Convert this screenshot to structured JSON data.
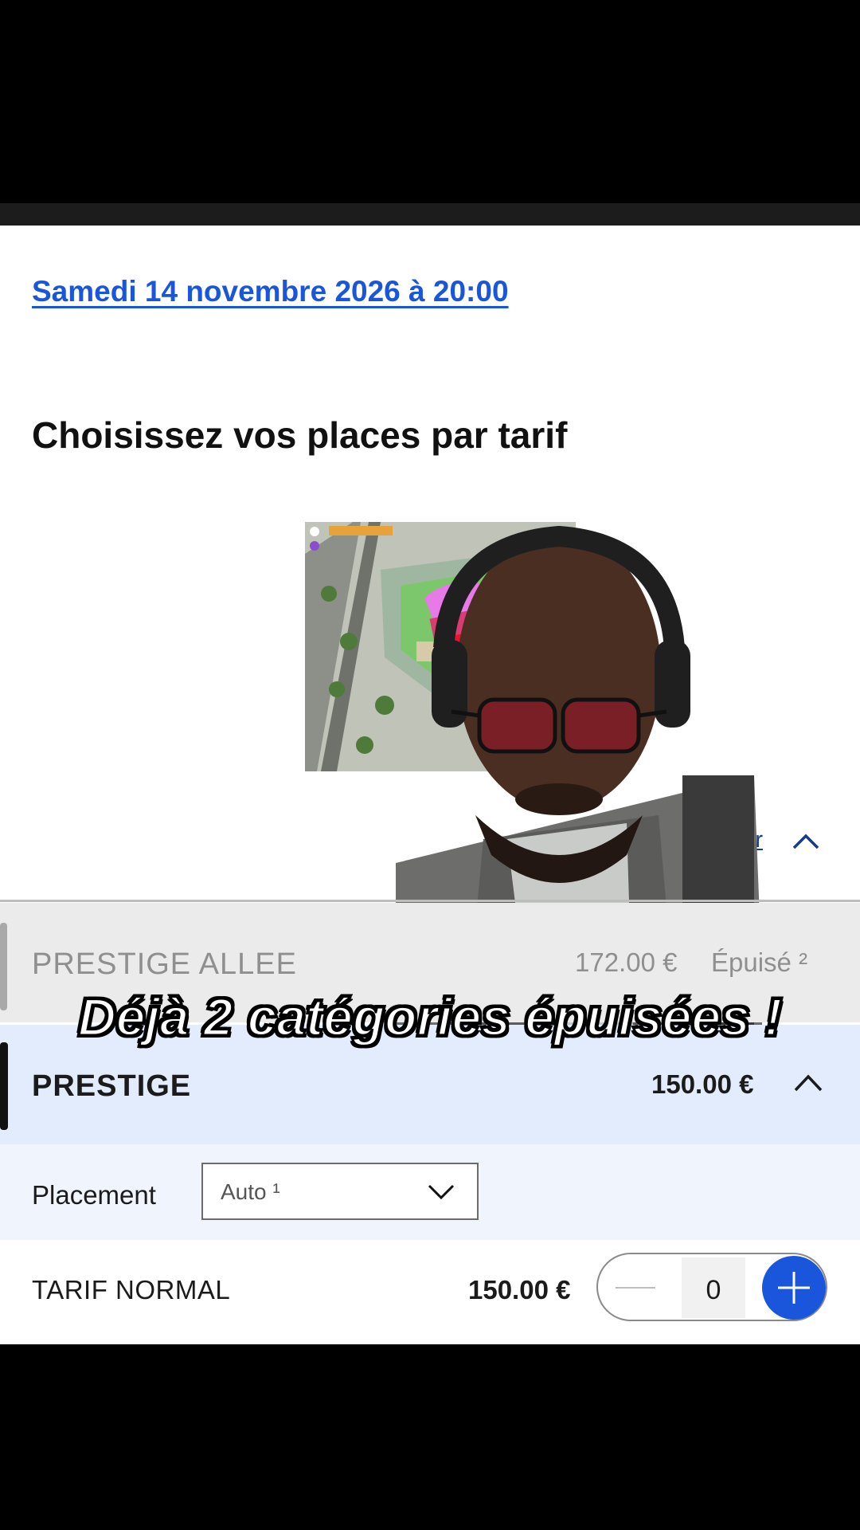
{
  "event": {
    "date_link": "Samedi 14 novembre 2026 à 20:00"
  },
  "section": {
    "heading": "Choisissez vos places par tarif"
  },
  "collapse": {
    "label": "Tout replier"
  },
  "categories": [
    {
      "name": "PRESTIGE ALLEE",
      "price": "172.00 €",
      "status": "Épuisé ²"
    },
    {
      "name": "PRESTIGE",
      "price": "150.00 €"
    }
  ],
  "placement": {
    "label": "Placement",
    "value": "Auto ¹"
  },
  "tarif": {
    "name": "TARIF NORMAL",
    "price": "150.00 €",
    "quantity": "0"
  },
  "overlay": {
    "caption": "Déjà 2 catégories épuisées !"
  },
  "colors": {
    "accent": "#1a56db",
    "selected_bg": "#e3ecfc",
    "soldout_bg": "#ebebeb"
  },
  "icons": [
    "magnifier-icon",
    "chevron-up-icon",
    "chevron-down-icon",
    "minus-icon",
    "plus-icon"
  ]
}
